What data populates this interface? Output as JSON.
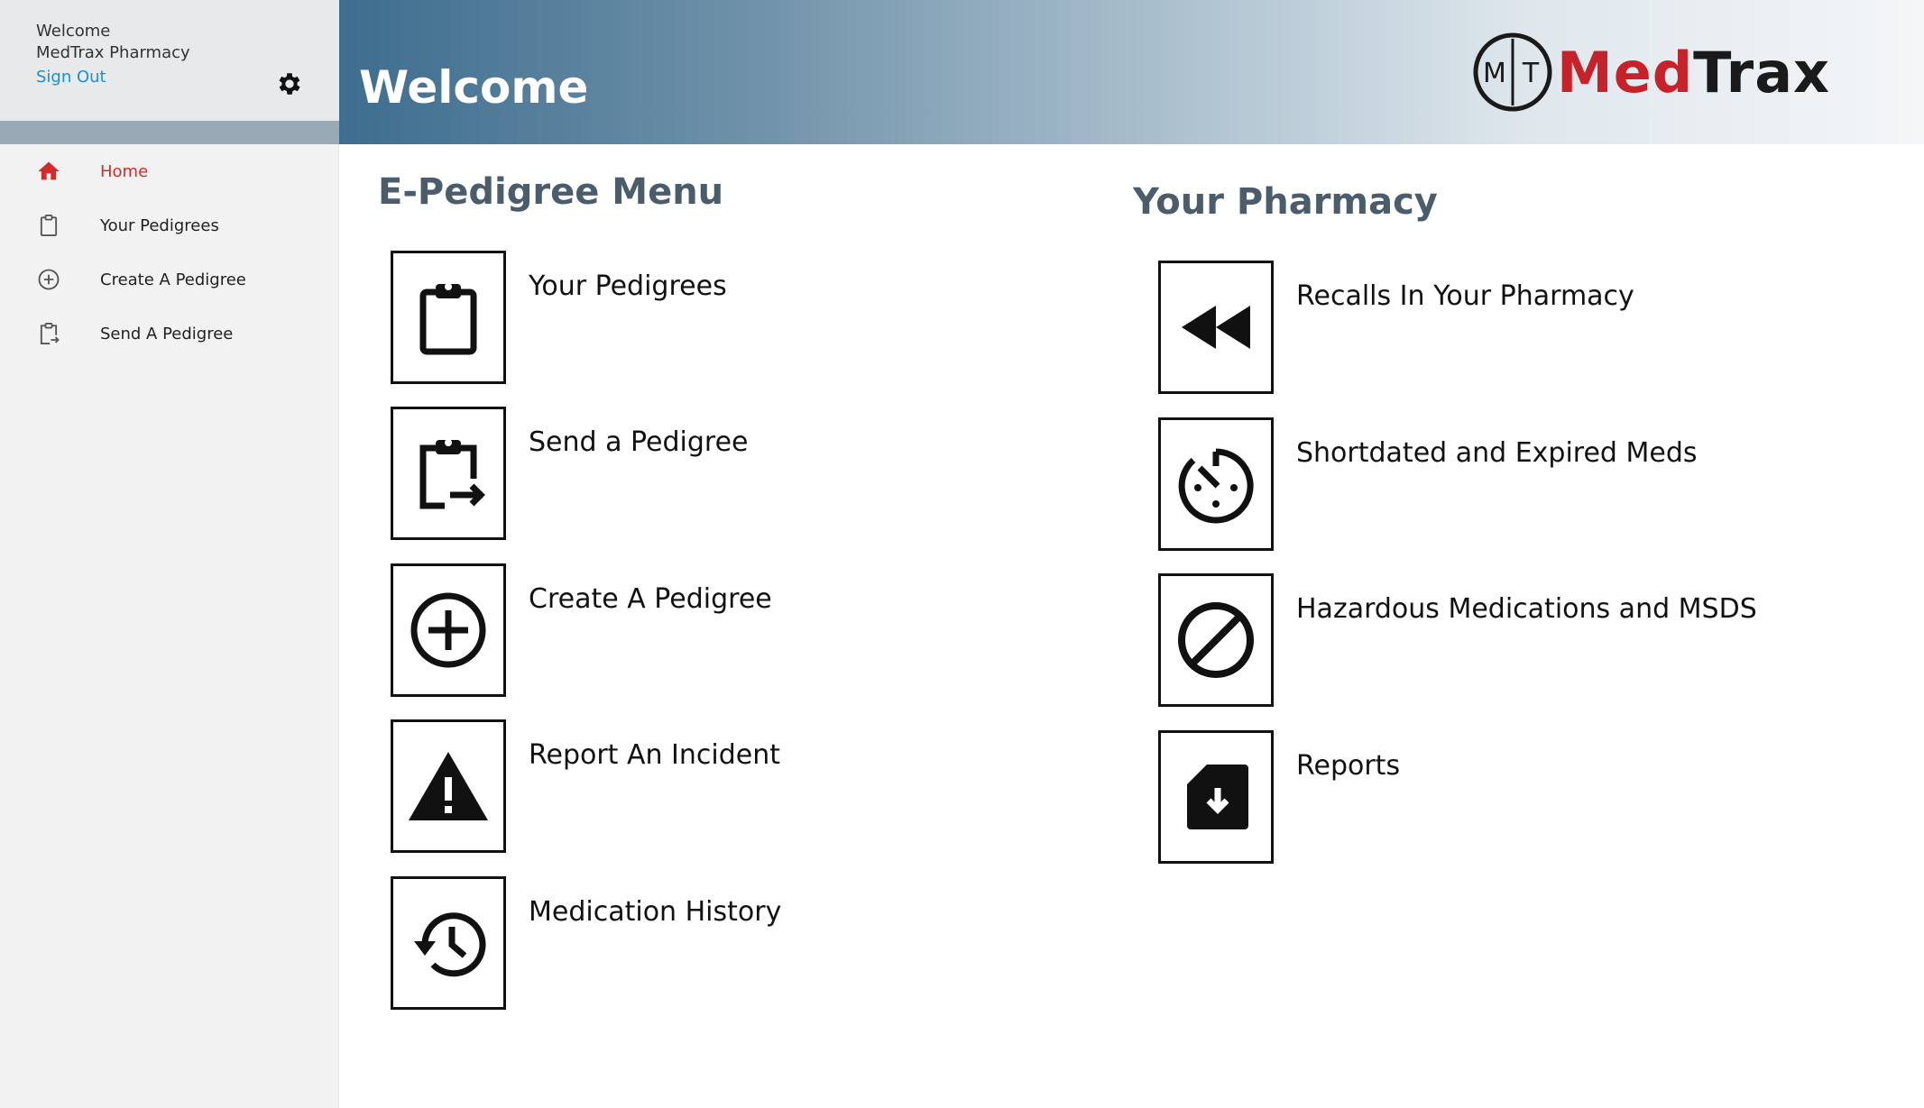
{
  "sidebar": {
    "welcome_label": "Welcome",
    "pharmacy_name": "MedTrax Pharmacy",
    "sign_out_label": "Sign Out",
    "settings_icon": "gear-icon",
    "items": [
      {
        "label": "Home",
        "icon": "home-icon",
        "active": true
      },
      {
        "label": "Your Pedigrees",
        "icon": "clipboard-icon",
        "active": false
      },
      {
        "label": "Create A Pedigree",
        "icon": "plus-circle-icon",
        "active": false
      },
      {
        "label": "Send A Pedigree",
        "icon": "clipboard-send-icon",
        "active": false
      }
    ]
  },
  "header": {
    "title": "Welcome",
    "logo_letters": "MT",
    "logo_med": "Med",
    "logo_trax": "Trax"
  },
  "epedigree": {
    "title": "E-Pedigree Menu",
    "items": [
      {
        "label": "Your Pedigrees",
        "icon": "clipboard-icon"
      },
      {
        "label": "Send a Pedigree",
        "icon": "clipboard-send-icon"
      },
      {
        "label": "Create A Pedigree",
        "icon": "plus-circle-icon"
      },
      {
        "label": "Report An Incident",
        "icon": "warning-icon"
      },
      {
        "label": "Medication History",
        "icon": "history-icon"
      }
    ]
  },
  "pharmacy": {
    "title": "Your Pharmacy",
    "items": [
      {
        "label": "Recalls In Your Pharmacy",
        "icon": "rewind-icon"
      },
      {
        "label": "Shortdated and Expired Meds",
        "icon": "timer-icon"
      },
      {
        "label": "Hazardous Medications and MSDS",
        "icon": "prohibited-icon"
      },
      {
        "label": "Reports",
        "icon": "file-download-icon"
      }
    ]
  },
  "colors": {
    "accent_red": "#d32a2a",
    "link_blue": "#1a8fd6",
    "header_start": "#3e6d8f",
    "section_title": "#4b5d6b"
  }
}
